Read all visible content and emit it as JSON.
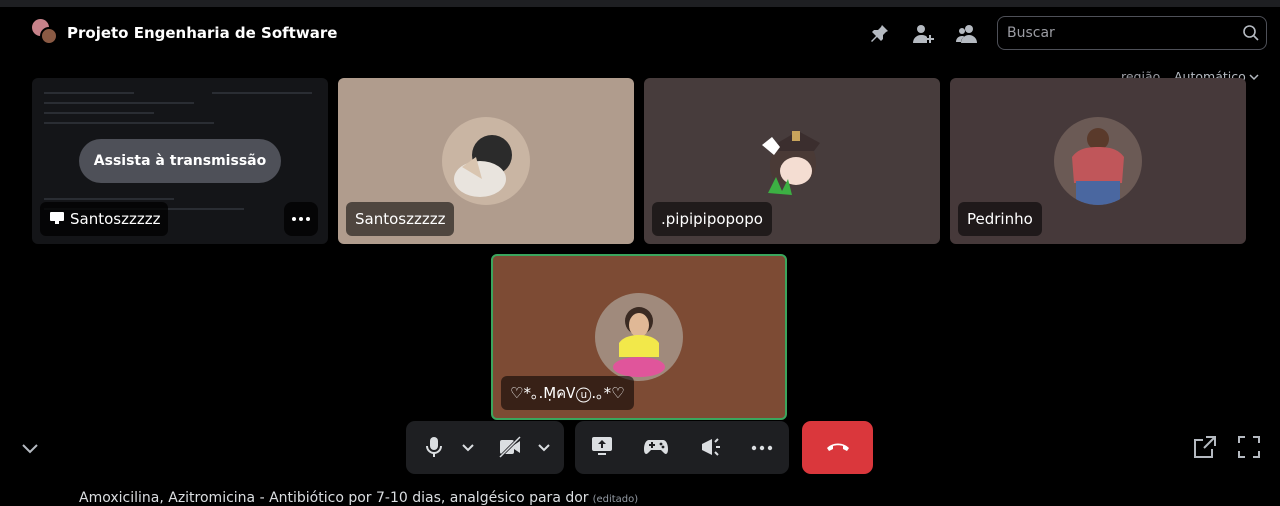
{
  "header": {
    "channel_title": "Projeto Engenharia de Software",
    "search_placeholder": "Buscar",
    "icons": [
      "pin-icon",
      "add-member-icon",
      "member-list-icon",
      "search-icon"
    ]
  },
  "region": {
    "label": "região",
    "value": "Automático"
  },
  "tiles": [
    {
      "type": "stream",
      "watch_label": "Assista à transmissão",
      "name": "Santoszzzzz",
      "more_icon": "more-icon",
      "background": "#141518"
    },
    {
      "type": "user",
      "name": "Santoszzzzz",
      "background": "#b09c8d"
    },
    {
      "type": "user",
      "name": ".pipipipopopo",
      "background": "#473c3c"
    },
    {
      "type": "user",
      "name": "Pedrinho",
      "background": "#46393a"
    },
    {
      "type": "user",
      "name": "♡*｡.ṂคᏙⓤ.｡*♡",
      "background": "#7d4b34",
      "speaking": true,
      "speaking_color": "#3ba55d"
    }
  ],
  "controls": {
    "left": [
      "microphone-icon",
      "chevron-down-icon",
      "camera-off-icon",
      "chevron-down-icon"
    ],
    "middle": [
      "screen-share-icon",
      "activities-icon",
      "soundboard-icon",
      "more-icon"
    ],
    "hangup": "hangup-icon",
    "right": [
      "pop-out-icon",
      "fullscreen-icon"
    ],
    "collapse": "chevron-down-icon"
  },
  "bottom_text": {
    "message": "Amoxicilina, Azitromicina - Antibiótico por 7-10 dias, analgésico para dor",
    "meta": "(editado)"
  },
  "colors": {
    "hangup": "#da373c",
    "speaking": "#3ba55d",
    "control_bg": "#1e1f22"
  }
}
